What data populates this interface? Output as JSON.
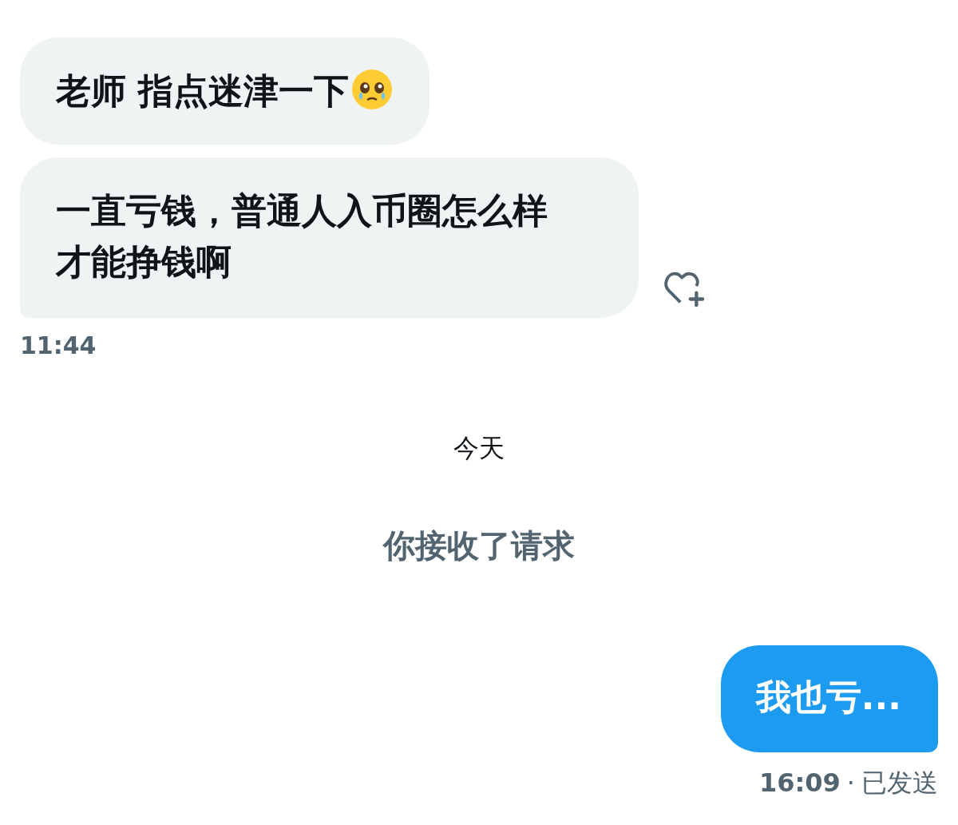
{
  "items": [
    {
      "kind": "incoming",
      "text": "老师 指点迷津一下",
      "emoji": true
    },
    {
      "kind": "incoming",
      "text": "一直亏钱，普通人入币圈怎么样才能挣钱啊",
      "reaction_button": true
    },
    {
      "kind": "timestamp",
      "text": "11:44"
    },
    {
      "kind": "date",
      "text": "今天"
    },
    {
      "kind": "system",
      "text": "你接收了请求"
    },
    {
      "kind": "outgoing",
      "text": "我也亏..."
    },
    {
      "kind": "receipt",
      "time": "16:09",
      "separator": "·",
      "status": "已发送"
    }
  ]
}
